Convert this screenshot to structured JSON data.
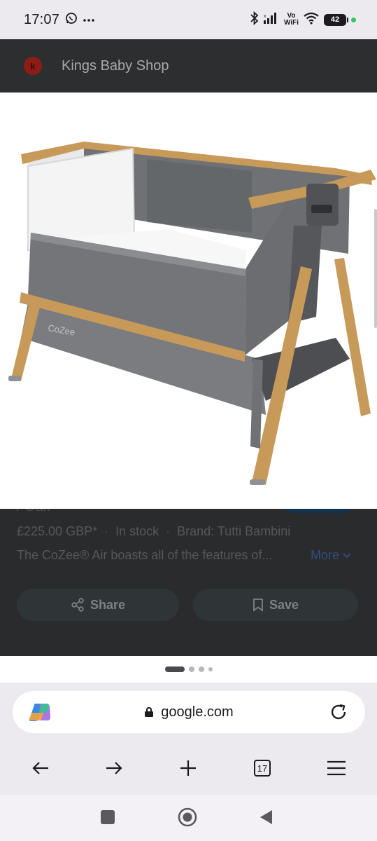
{
  "status_bar": {
    "time": "17:07",
    "notification_icons": [
      "whatsapp-icon",
      "more-dots-icon"
    ],
    "vowifi_top": "Vo",
    "vowifi_bottom": "WiFi",
    "battery_level": "42",
    "right_icons": [
      "bluetooth-icon",
      "signal-icon",
      "vowifi-icon",
      "wifi-icon",
      "battery-icon",
      "privacy-dot-icon"
    ]
  },
  "viewer": {
    "site_name": "Kings Baby Shop",
    "favicon_letter": "k",
    "image_icon": "bedside-crib-product-image"
  },
  "result": {
    "title_fragment": "/ Oak",
    "price": "£225.00 GBP*",
    "separator": "·",
    "stock": "In stock",
    "brand": "Brand: Tutti Bambini",
    "description": "The CoZee® Air boasts all of the features of...",
    "more_label": "More",
    "share_label": "Share",
    "save_label": "Save"
  },
  "carousel": {
    "page_count": 4,
    "active_index": 0
  },
  "browser": {
    "url": "google.com",
    "tab_count": "17",
    "nav_icons": [
      "back-arrow-icon",
      "forward-arrow-icon",
      "new-tab-plus-icon",
      "tab-switcher-icon",
      "menu-icon"
    ]
  },
  "colors": {
    "status_bar_bg": "#eceaef",
    "overlay_bg": "#2a2b2d",
    "favicon": "#8d1d14",
    "more_link": "#2f4e7e"
  }
}
